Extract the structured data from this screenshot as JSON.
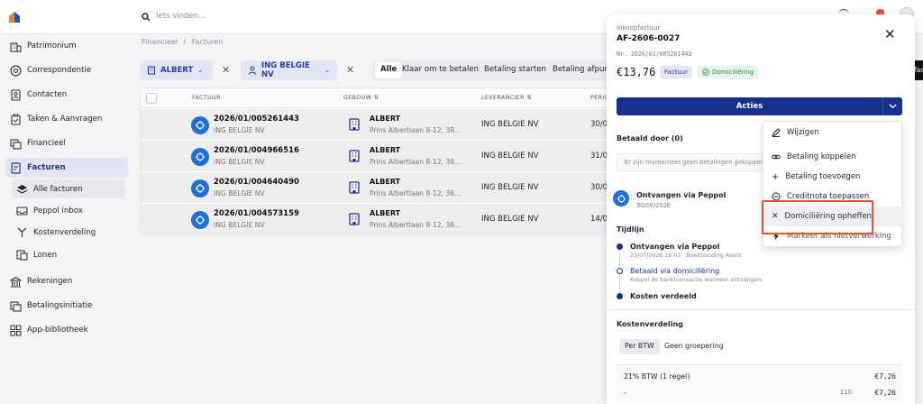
{
  "header": {
    "search_placeholder": "Iets vinden..."
  },
  "sidebar": {
    "items": [
      {
        "label": "Patrimonium",
        "icon": "building-icon"
      },
      {
        "label": "Correspondentie",
        "icon": "at-icon"
      },
      {
        "label": "Contacten",
        "icon": "contacts-icon"
      },
      {
        "label": "Taken & Aanvragen",
        "icon": "clipboard-icon"
      },
      {
        "label": "Financieel",
        "icon": "finance-icon"
      },
      {
        "label": "Facturen",
        "icon": "invoice-icon"
      },
      {
        "label": "Alle facturen",
        "icon": "stack-icon"
      },
      {
        "label": "Peppol inbox",
        "icon": "inbox-icon"
      },
      {
        "label": "Kostenverdeling",
        "icon": "split-icon"
      },
      {
        "label": "Lonen",
        "icon": "payroll-icon"
      },
      {
        "label": "Rekeningen",
        "icon": "bank-icon"
      },
      {
        "label": "Betalingsinitiatie",
        "icon": "payment-icon"
      },
      {
        "label": "App-bibliotheek",
        "icon": "grid-icon"
      }
    ]
  },
  "breadcrumb": {
    "parent": "Financieel",
    "sep": "/",
    "current": "Facturen"
  },
  "filters": {
    "building": "ALBERT",
    "supplier": "ING BELGIE NV",
    "segments": [
      "Alle",
      "Klaar om te betalen",
      "Betaling starten",
      "Betaling afpun"
    ]
  },
  "table": {
    "headers": [
      "FACTUUR",
      "GEBOUW ⇅",
      "LEVERANCIER ⇅",
      "PERIO"
    ],
    "rows": [
      {
        "number": "2026/01/005261443",
        "supplier_sub": "ING BELGIE NV",
        "building": "ALBERT",
        "address": "Prins Albertlaan 8-12, 38...",
        "supplier": "ING BELGIE NV",
        "period": "30/0"
      },
      {
        "number": "2026/01/004966516",
        "supplier_sub": "ING BELGIE NV",
        "building": "ALBERT",
        "address": "Prins Albertlaan 8-12, 38...",
        "supplier": "ING BELGIE NV",
        "period": "31/0"
      },
      {
        "number": "2026/01/004640490",
        "supplier_sub": "ING BELGIE NV",
        "building": "ALBERT",
        "address": "Prins Albertlaan 8-12, 38...",
        "supplier": "ING BELGIE NV",
        "period": "30/0"
      },
      {
        "number": "2026/01/004573159",
        "supplier_sub": "ING BELGIE NV",
        "building": "ALBERT",
        "address": "Prins Albertlaan 8-12, 38...",
        "supplier": "ING BELGIE NV",
        "period": "14/0"
      }
    ]
  },
  "panel": {
    "kicker": "Inkoopfactuur",
    "title": "AF-2606-0027",
    "ref": "Nr. 2026/01/005261443",
    "amount": "€13,76",
    "badge_type": "Factuur",
    "badge_status": "Domiciliëring",
    "actions_label": "Acties",
    "paid_by": "Betaald door (0)",
    "no_payments": "Er zijn momenteel geen betalingen gekoppeld",
    "received_title": "Ontvangen via Peppol",
    "received_date": "30/06/2026",
    "timeline_label": "Tijdlijn",
    "timeline": [
      {
        "title": "Ontvangen via Peppol",
        "sub": "23/07/2026 16:02 · Boekhouding Asent"
      },
      {
        "title": "Betaald via domiciliëring",
        "sub": "Koppel de banktransactie wanneer ontvangen."
      },
      {
        "title": "Kosten verdeeld",
        "sub": ""
      }
    ],
    "cost_label": "Kostenverdeling",
    "cost_tabs": [
      "Per BTW",
      "Geen groepering"
    ],
    "vat_label": "21% BTW (1 regel)",
    "vat_amount": "€7,26",
    "line_dash": "-",
    "line_code": "Σ10",
    "line_amount": "€7,26"
  },
  "dropdown": {
    "items": [
      {
        "label": "Wijzigen",
        "icon": "pencil-icon"
      },
      {
        "label": "Betaling koppelen",
        "icon": "link-icon"
      },
      {
        "label": "Betaling toevoegen",
        "icon": "plus-icon"
      },
      {
        "label": "Creditnota toepassen",
        "icon": "credit-icon"
      },
      {
        "label": "Domiciliëring opheffen",
        "icon": "x-icon"
      },
      {
        "label": "Markeer als nietverwerking",
        "icon": "flash-icon"
      }
    ]
  },
  "edge_label": "fac",
  "colors": {
    "primary": "#16318c",
    "accent": "#1e6fd9",
    "highlight": "#e4523a",
    "success": "#2e9e4f"
  }
}
